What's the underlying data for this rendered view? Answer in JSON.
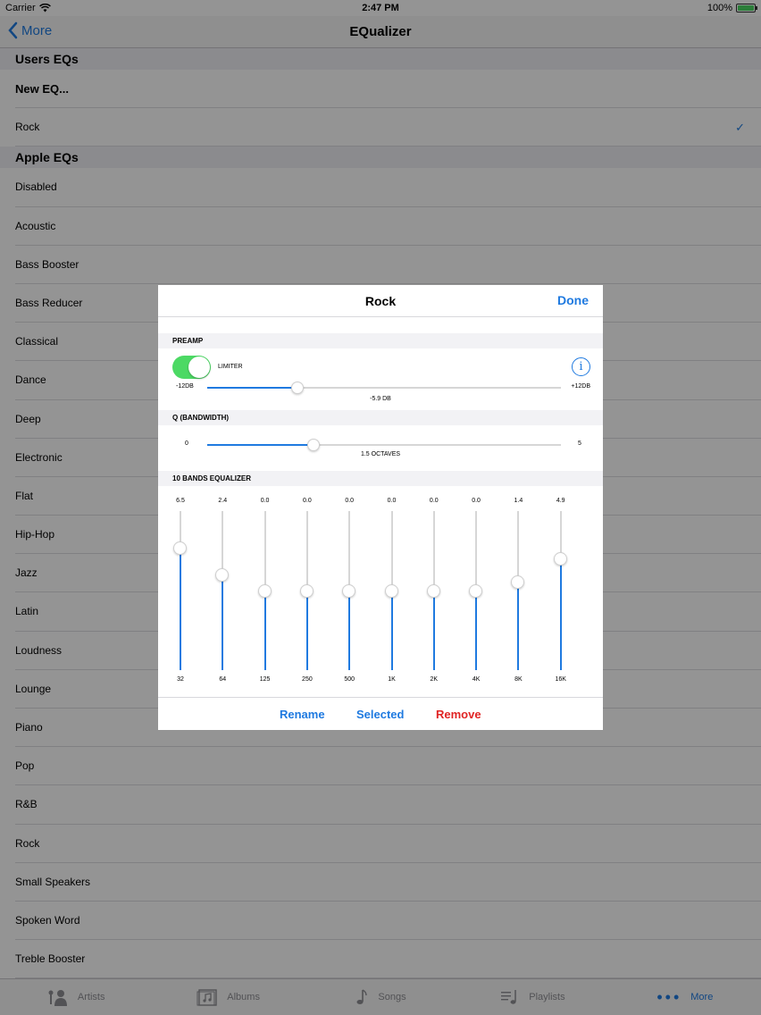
{
  "status": {
    "carrier": "Carrier",
    "time": "2:47 PM",
    "battery": "100%"
  },
  "nav": {
    "back_label": "More",
    "title": "EQualizer"
  },
  "users_section": {
    "header": "Users EQs",
    "new_item": "New EQ...",
    "items": [
      "Rock"
    ],
    "checked": "Rock"
  },
  "apple_section": {
    "header": "Apple EQs",
    "items": [
      "Disabled",
      "Acoustic",
      "Bass Booster",
      "Bass Reducer",
      "Classical",
      "Dance",
      "Deep",
      "Electronic",
      "Flat",
      "Hip-Hop",
      "Jazz",
      "Latin",
      "Loudness",
      "Lounge",
      "Piano",
      "Pop",
      "R&B",
      "Rock",
      "Small Speakers",
      "Spoken Word",
      "Treble Booster"
    ]
  },
  "tabs": [
    {
      "label": "Artists",
      "icon": "artists-icon",
      "active": false
    },
    {
      "label": "Albums",
      "icon": "albums-icon",
      "active": false
    },
    {
      "label": "Songs",
      "icon": "songs-icon",
      "active": false
    },
    {
      "label": "Playlists",
      "icon": "playlists-icon",
      "active": false
    },
    {
      "label": "More",
      "icon": "more-icon",
      "active": true
    }
  ],
  "modal": {
    "title": "Rock",
    "done_label": "Done",
    "preamp": {
      "label": "PREAMP",
      "limiter_label": "LIMITER",
      "limiter_on": true,
      "min_label": "-12DB",
      "max_label": "+12DB",
      "value_label": "-5.9 DB",
      "min": -12,
      "max": 12,
      "value": -5.9
    },
    "q": {
      "label": "Q (BANDWIDTH)",
      "min_label": "0",
      "max_label": "5",
      "value_label": "1.5 OCTAVES",
      "min": 0,
      "max": 5,
      "value": 1.5
    },
    "bands": {
      "label": "10 BANDS EQUALIZER",
      "min": -12,
      "max": 12,
      "items": [
        {
          "freq": "32",
          "value_label": "6.5",
          "value": 6.5
        },
        {
          "freq": "64",
          "value_label": "2.4",
          "value": 2.4
        },
        {
          "freq": "125",
          "value_label": "0.0",
          "value": 0.0
        },
        {
          "freq": "250",
          "value_label": "0.0",
          "value": 0.0
        },
        {
          "freq": "500",
          "value_label": "0.0",
          "value": 0.0
        },
        {
          "freq": "1K",
          "value_label": "0.0",
          "value": 0.0
        },
        {
          "freq": "2K",
          "value_label": "0.0",
          "value": 0.0
        },
        {
          "freq": "4K",
          "value_label": "0.0",
          "value": 0.0
        },
        {
          "freq": "8K",
          "value_label": "1.4",
          "value": 1.4
        },
        {
          "freq": "16K",
          "value_label": "4.9",
          "value": 4.9
        }
      ]
    },
    "footer": {
      "rename": "Rename",
      "selected": "Selected",
      "remove": "Remove"
    }
  },
  "colors": {
    "accent": "#1f7ae0",
    "toggle_on": "#4cd964",
    "destructive": "#e02424"
  }
}
